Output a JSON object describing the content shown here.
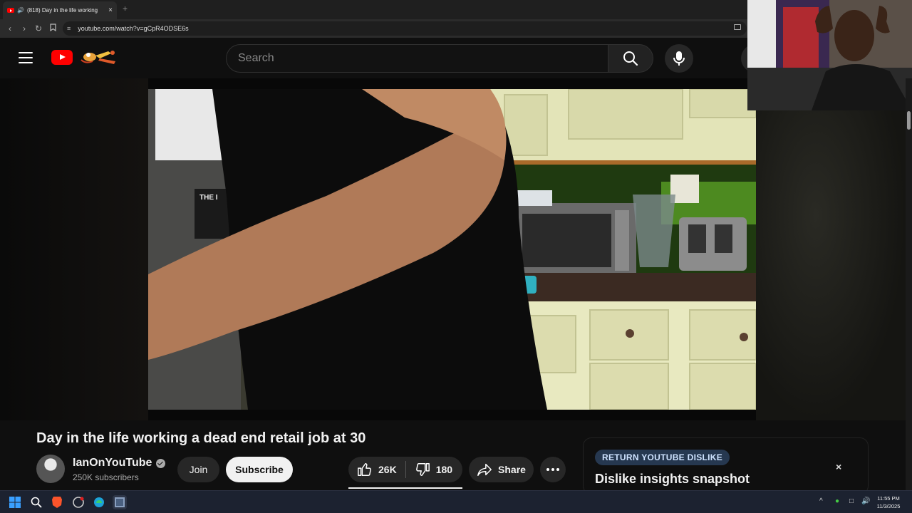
{
  "browser": {
    "tab_title": "(818) Day in the life working",
    "tab_audio_icon": "speaker-icon",
    "new_tab": "+",
    "url": "youtube.com/watch?v=gCpR4ODSE6s"
  },
  "masthead": {
    "search_placeholder": "Search"
  },
  "video": {
    "title": "Day in the life working a dead end retail job at 30"
  },
  "channel": {
    "name": "IanOnYouTube",
    "subscribers": "250K subscribers",
    "join_label": "Join",
    "subscribe_label": "Subscribe"
  },
  "actions": {
    "likes": "26K",
    "dislikes": "180",
    "share_label": "Share"
  },
  "ryd": {
    "badge": "RETURN YOUTUBE DISLIKE",
    "title": "Dislike insights snapshot",
    "close": "×"
  },
  "taskbar": {
    "time": "11:55 PM",
    "date": "11/3/2025"
  },
  "colors": {
    "brand_red": "#ff0000",
    "background": "#0f0f0f",
    "chip": "#272727",
    "badge_bg": "#263850"
  }
}
